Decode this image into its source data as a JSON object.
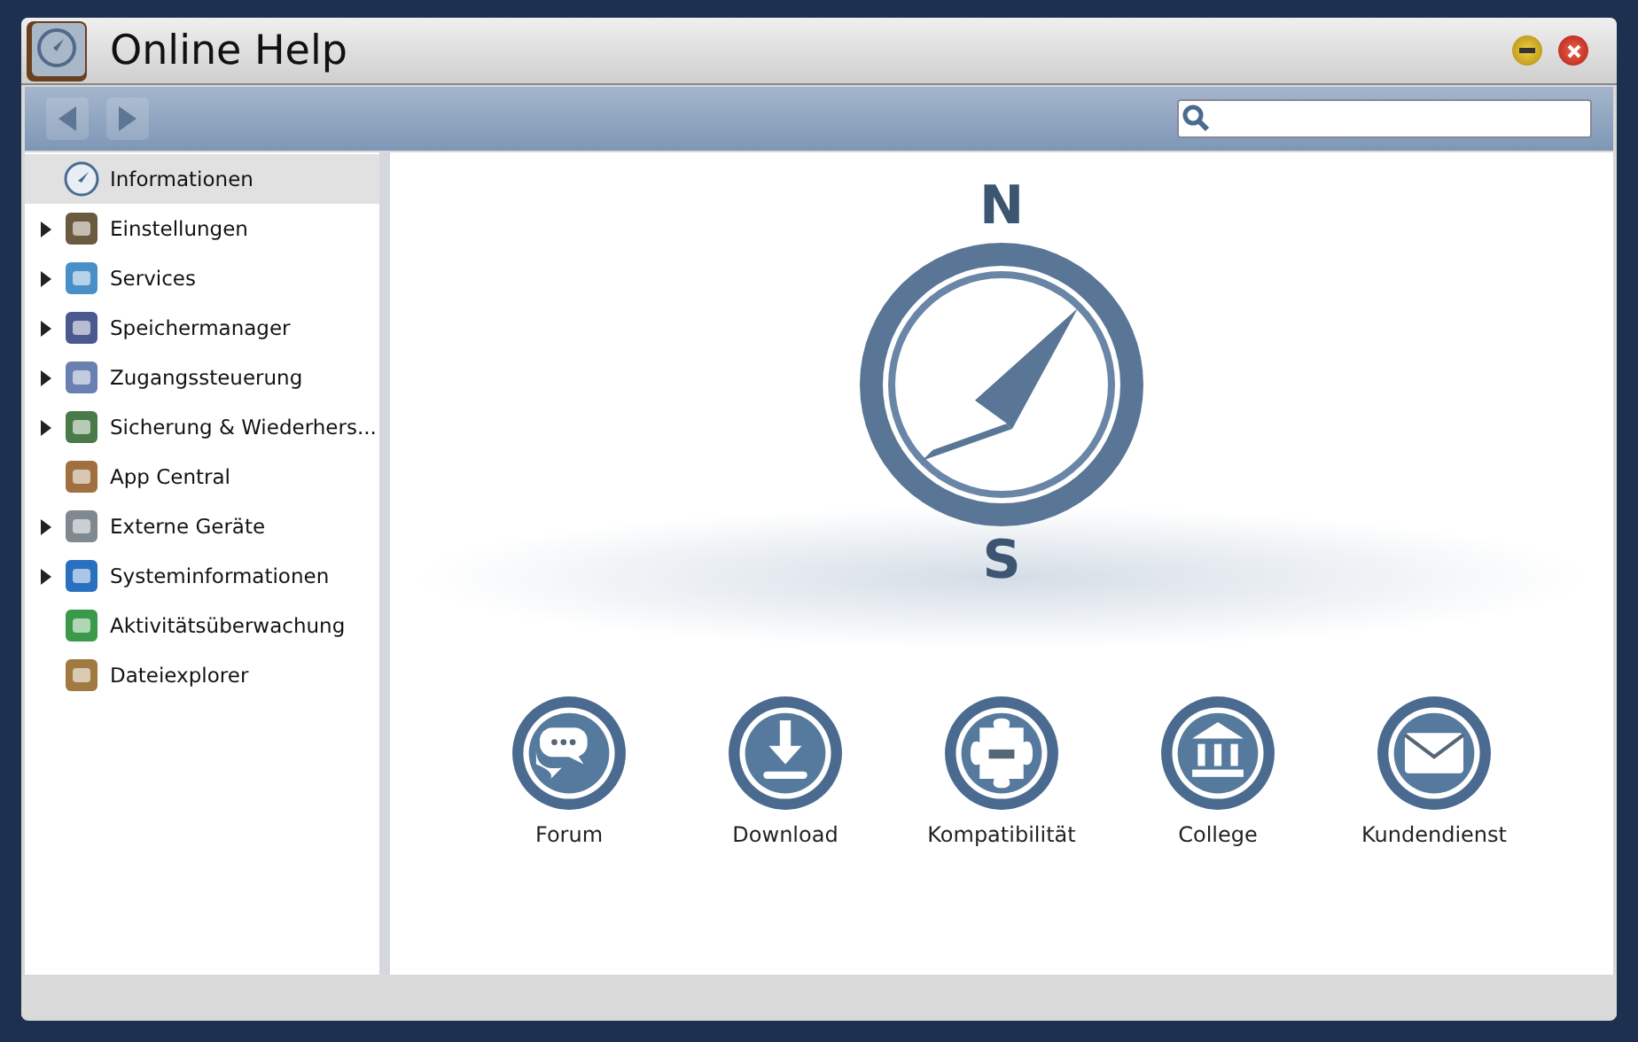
{
  "window": {
    "title": "Online Help"
  },
  "toolbar": {
    "back": {
      "disabled": true
    },
    "forward": {
      "disabled": true
    }
  },
  "sidebar": {
    "items": [
      {
        "label": "Informationen",
        "kind": "leaf",
        "selected": true
      },
      {
        "label": "Einstellungen",
        "kind": "group",
        "selected": false
      },
      {
        "label": "Services",
        "kind": "group",
        "selected": false
      },
      {
        "label": "Speichermanager",
        "kind": "group",
        "selected": false
      },
      {
        "label": "Zugangssteuerung",
        "kind": "group",
        "selected": false
      },
      {
        "label": "Sicherung & Wiederhers...",
        "kind": "group",
        "selected": false
      },
      {
        "label": "App Central",
        "kind": "leaf",
        "selected": false
      },
      {
        "label": "Externe Geräte",
        "kind": "group",
        "selected": false
      },
      {
        "label": "Systeminformationen",
        "kind": "group",
        "selected": false
      },
      {
        "label": "Aktivitätsüberwachung",
        "kind": "leaf",
        "selected": false
      },
      {
        "label": "Dateiexplorer",
        "kind": "leaf",
        "selected": false
      }
    ]
  },
  "content": {
    "compass": {
      "north": "N",
      "south": "S"
    },
    "links": [
      {
        "label": "Forum",
        "kind": "forum"
      },
      {
        "label": "Download",
        "kind": "download"
      },
      {
        "label": "Kompatibilität",
        "kind": "puzzle"
      },
      {
        "label": "College",
        "kind": "college"
      },
      {
        "label": "Kundendienst",
        "kind": "mail"
      }
    ]
  }
}
